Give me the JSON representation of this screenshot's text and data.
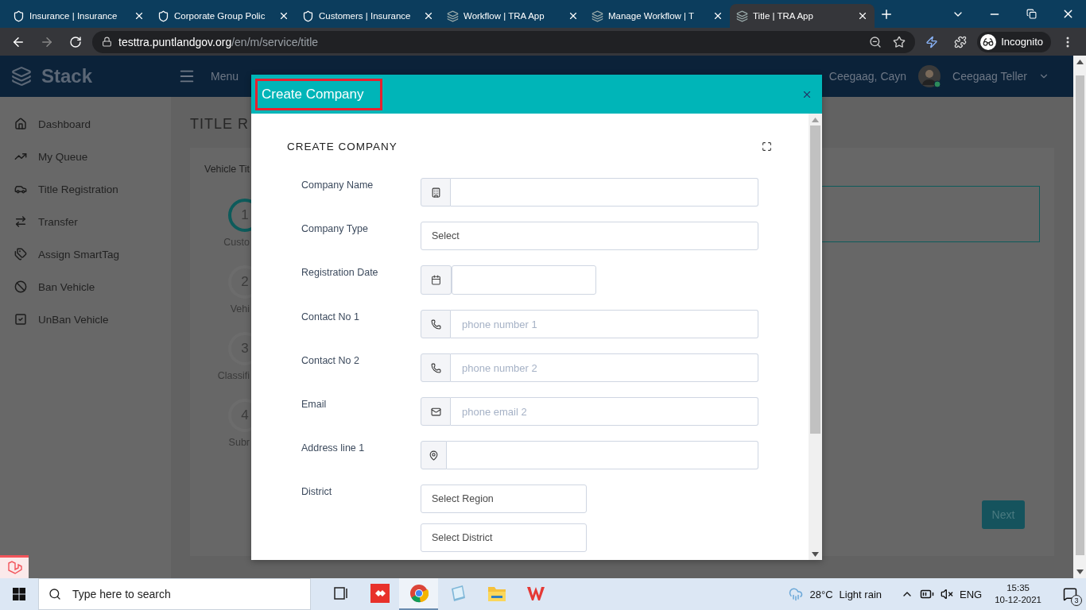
{
  "browser": {
    "tabs": [
      {
        "kind": "shield",
        "title": "Insurance | Insurance",
        "selected": false
      },
      {
        "kind": "shield",
        "title": "Corporate Group Polic",
        "selected": false
      },
      {
        "kind": "shield",
        "title": "Customers | Insurance",
        "selected": false
      },
      {
        "kind": "layers",
        "title": "Workflow | TRA App",
        "selected": false
      },
      {
        "kind": "layers",
        "title": "Manage Workflow | T",
        "selected": false
      },
      {
        "kind": "layers",
        "title": "Title | TRA App",
        "selected": true
      }
    ],
    "url": {
      "host": "testtra.puntlandgov.org",
      "path": "/en/m/service/title"
    },
    "profile": "Incognito"
  },
  "app": {
    "logo": "Stack",
    "menu": "Menu",
    "user_short": "Ceegaag, Cayn",
    "user_name": "Ceegaag Teller"
  },
  "sidebar": {
    "items": [
      {
        "kind": "home",
        "label": "Dashboard"
      },
      {
        "kind": "chart",
        "label": "My Queue"
      },
      {
        "kind": "car",
        "label": "Title Registration"
      },
      {
        "kind": "transfer",
        "label": "Transfer"
      },
      {
        "kind": "tags",
        "label": "Assign SmartTag"
      },
      {
        "kind": "ban",
        "label": "Ban Vehicle"
      },
      {
        "kind": "check",
        "label": "UnBan Vehicle"
      }
    ]
  },
  "page": {
    "title": "TITLE R",
    "card_title": "Vehicle Tit",
    "steps": [
      {
        "number": "1",
        "label": "Custo",
        "selected": true
      },
      {
        "number": "2",
        "label": "Vehi",
        "selected": false
      },
      {
        "number": "3",
        "label": "Classifi",
        "selected": false
      },
      {
        "number": "4",
        "label": "Subr",
        "selected": false
      }
    ],
    "next_button": "Next"
  },
  "modal": {
    "title": "Create Company",
    "heading": "CREATE COMPANY",
    "fields": [
      {
        "kind": "building",
        "label": "Company Name"
      },
      {
        "kind": "select",
        "label": "Company Type",
        "value": "Select"
      },
      {
        "kind": "date",
        "label": "Registration Date"
      },
      {
        "kind": "phone",
        "label": "Contact No 1",
        "placeholder": "phone number 1"
      },
      {
        "kind": "phone",
        "label": "Contact No 2",
        "placeholder": "phone number 2"
      },
      {
        "kind": "mail",
        "label": "Email",
        "placeholder": "phone email 2"
      },
      {
        "kind": "pin",
        "label": "Address line 1"
      },
      {
        "kind": "selects",
        "label": "District",
        "values": [
          "Select Region",
          "Select District"
        ]
      }
    ]
  },
  "taskbar": {
    "search": "Type here to search",
    "apps": [
      {
        "kind": "remote",
        "selected": false
      },
      {
        "kind": "browser",
        "selected": true
      },
      {
        "kind": "notepad",
        "selected": false
      },
      {
        "kind": "folder",
        "selected": false
      },
      {
        "kind": "office",
        "selected": false
      }
    ],
    "weather": {
      "temp": "28°C",
      "condition": "Light rain"
    },
    "language": "ENG",
    "time": "15:35",
    "date": "10-12-2021",
    "notifications": "3"
  }
}
